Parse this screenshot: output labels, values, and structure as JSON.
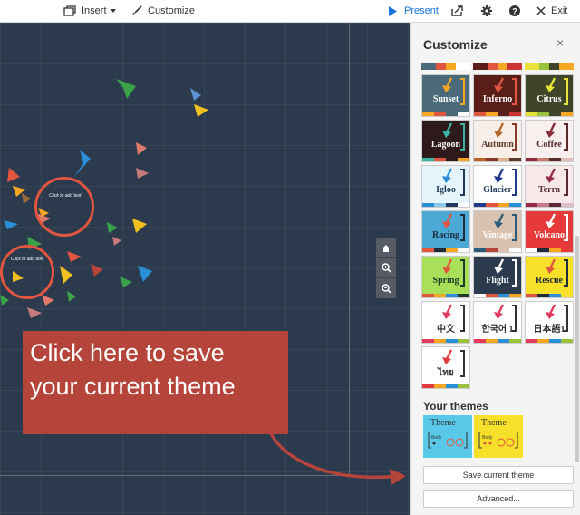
{
  "toolbar": {
    "insert_label": "Insert",
    "customize_label": "Customize",
    "present_label": "Present",
    "exit_label": "Exit",
    "icons": [
      "insert-icon",
      "brush-icon",
      "play-icon",
      "share-icon",
      "gear-icon",
      "help-icon",
      "exit-icon"
    ],
    "accent": "#1a73d9"
  },
  "canvas": {
    "bg": "#2b3a4d",
    "placeholder_text_1": "Click to add text",
    "placeholder_text_2": "Click to add text",
    "circle_color": "#e2553f"
  },
  "zoom": {
    "icons": [
      "home-icon",
      "zoom-in-icon",
      "zoom-out-icon"
    ]
  },
  "callout": {
    "line1": "Click here to save",
    "line2": "your current theme",
    "bg": "#b5443a"
  },
  "panel": {
    "title": "Customize",
    "close_label": "×",
    "themes": [
      {
        "name": "Sunset",
        "bg": "#4a6a7a",
        "fg": "#ffffff",
        "arrow": "#f5a623",
        "bracket": "#f5a623",
        "strip": [
          "#f5a623",
          "#e2553f",
          "#4a6a7a",
          "#fff"
        ]
      },
      {
        "name": "Inferno",
        "bg": "#5a1e18",
        "fg": "#ffffff",
        "arrow": "#e2553f",
        "bracket": "#e2553f",
        "strip": [
          "#e2553f",
          "#f5a623",
          "#5a1e18",
          "#c33"
        ]
      },
      {
        "name": "Citrus",
        "bg": "#3f4528",
        "fg": "#ffffff",
        "arrow": "#e8e33a",
        "bracket": "#e8e33a",
        "strip": [
          "#e8e33a",
          "#9cc13a",
          "#3f4528",
          "#f5a623"
        ]
      },
      {
        "name": "Lagoon",
        "bg": "#2e1a1a",
        "fg": "#ffffff",
        "arrow": "#3ab5a5",
        "bracket": "#3ab5a5",
        "strip": [
          "#3ab5a5",
          "#e2553f",
          "#2e1a1a",
          "#f5a623"
        ]
      },
      {
        "name": "Autumn",
        "bg": "#f7efe8",
        "fg": "#5a3a2a",
        "arrow": "#b8652a",
        "bracket": "#8a3a2a",
        "strip": [
          "#b8652a",
          "#8a3a2a",
          "#e0b28a",
          "#5a3a2a"
        ]
      },
      {
        "name": "Coffee",
        "bg": "#f8f0ee",
        "fg": "#5a2a2a",
        "arrow": "#8a2a3a",
        "bracket": "#5a2a2a",
        "strip": [
          "#8a2a3a",
          "#c77a6a",
          "#5a2a2a",
          "#e0c0b8"
        ]
      },
      {
        "name": "Igloo",
        "bg": "#e6f4fb",
        "fg": "#1f3a5a",
        "arrow": "#2a8fd9",
        "bracket": "#1f3a5a",
        "strip": [
          "#2a8fd9",
          "#8cc8ea",
          "#1f3a5a",
          "#fff"
        ]
      },
      {
        "name": "Glacier",
        "bg": "#ffffff",
        "fg": "#1f3a5a",
        "arrow": "#1f3a8a",
        "bracket": "#1f3a8a",
        "strip": [
          "#1f3a8a",
          "#e2553f",
          "#f5a623",
          "#2a8fd9"
        ]
      },
      {
        "name": "Terra",
        "bg": "#f8e8ea",
        "fg": "#5a2a3a",
        "arrow": "#9a2a4a",
        "bracket": "#5a2a3a",
        "strip": [
          "#9a2a4a",
          "#c77a8a",
          "#5a2a3a",
          "#e0c0c8"
        ]
      },
      {
        "name": "Racing",
        "bg": "#4aa9d5",
        "fg": "#1f2a3a",
        "arrow": "#e2553f",
        "bracket": "#1f2a3a",
        "strip": [
          "#e2553f",
          "#1f2a3a",
          "#f5a623",
          "#fff"
        ]
      },
      {
        "name": "Vintage",
        "bg": "#d9c3b0",
        "fg": "#ffffff",
        "arrow": "#2a5a7a",
        "bracket": "#2a5a7a",
        "strip": [
          "#2a5a7a",
          "#b5443a",
          "#d9c3b0",
          "#fff"
        ]
      },
      {
        "name": "Volcano",
        "bg": "#e63a3a",
        "fg": "#ffffff",
        "arrow": "#ffffff",
        "bracket": "#ffffff",
        "strip": [
          "#fff",
          "#1f2a3a",
          "#f5a623",
          "#e63a3a"
        ]
      },
      {
        "name": "Spring",
        "bg": "#a9e05a",
        "fg": "#1f3a2a",
        "arrow": "#e2553f",
        "bracket": "#1f3a2a",
        "strip": [
          "#e2553f",
          "#f5a623",
          "#2a8fd9",
          "#1f3a2a"
        ]
      },
      {
        "name": "Flight",
        "bg": "#2b3a4d",
        "fg": "#ffffff",
        "arrow": "#ffffff",
        "bracket": "#ffffff",
        "strip": [
          "#fff",
          "#e2553f",
          "#2a8fd9",
          "#f5a623"
        ]
      },
      {
        "name": "Rescue",
        "bg": "#f7e02a",
        "fg": "#1f2a3a",
        "arrow": "#e2553f",
        "bracket": "#1f2a3a",
        "strip": [
          "#e2553f",
          "#1f2a3a",
          "#2a8fd9",
          "#f7e02a"
        ]
      },
      {
        "name": "中文",
        "bg": "#ffffff",
        "fg": "#333333",
        "arrow": "#e23a5a",
        "bracket": "#333333",
        "strip": [
          "#e23a5a",
          "#f5a623",
          "#2a8fd9",
          "#9cc13a"
        ]
      },
      {
        "name": "한국어 1",
        "bg": "#ffffff",
        "fg": "#333333",
        "arrow": "#e23a5a",
        "bracket": "#333333",
        "strip": [
          "#e23a5a",
          "#f5a623",
          "#2a8fd9",
          "#9cc13a"
        ]
      },
      {
        "name": "日本語1",
        "bg": "#ffffff",
        "fg": "#333333",
        "arrow": "#e23a5a",
        "bracket": "#333333",
        "strip": [
          "#e23a5a",
          "#f5a623",
          "#2a8fd9",
          "#9cc13a"
        ]
      },
      {
        "name": "ไทย",
        "bg": "#ffffff",
        "fg": "#333333",
        "arrow": "#e23a3a",
        "bracket": "#333333",
        "strip": [
          "#e23a3a",
          "#f5a623",
          "#2a8fd9",
          "#9cc13a"
        ]
      }
    ],
    "your_themes_label": "Your themes",
    "my_themes": [
      {
        "title": "Theme",
        "body": "Body",
        "bg": "#5ac8e8"
      },
      {
        "title": "Theme",
        "body": "Body",
        "bg": "#f7e02a"
      }
    ],
    "save_button_label": "Save current theme",
    "advanced_button_label": "Advanced..."
  }
}
